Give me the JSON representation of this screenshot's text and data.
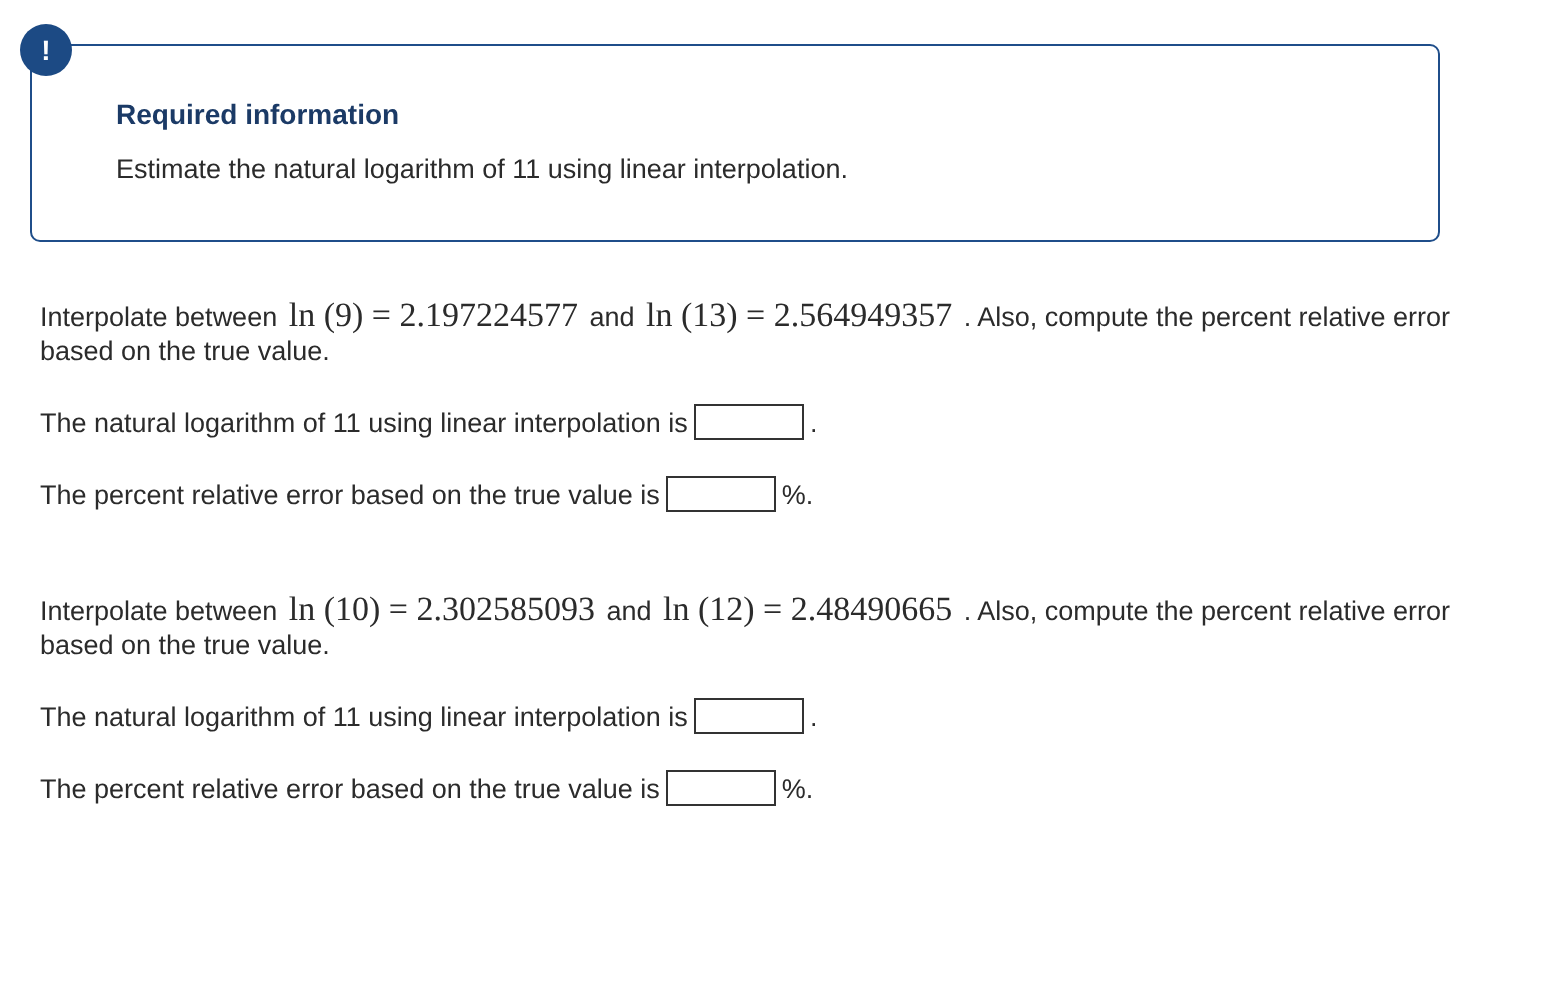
{
  "alert": {
    "icon_text": "!",
    "title": "Required information",
    "text": "Estimate the natural logarithm of 11 using linear interpolation."
  },
  "parts": [
    {
      "intro": [
        {
          "kind": "text",
          "text": "Interpolate between "
        },
        {
          "kind": "math",
          "text": "ln (9) = 2.197224577"
        },
        {
          "kind": "text",
          "text": " and "
        },
        {
          "kind": "math",
          "text": "ln (13) = 2.564949357"
        },
        {
          "kind": "text",
          "text": " . Also, compute the percent relative error based on the true value."
        }
      ],
      "answers": [
        {
          "label": "The natural logarithm of 11 using linear interpolation is",
          "suffix": "."
        },
        {
          "label": "The percent relative error based on the true value is",
          "suffix": "%."
        }
      ]
    },
    {
      "intro": [
        {
          "kind": "text",
          "text": "Interpolate between "
        },
        {
          "kind": "math",
          "text": "ln (10) = 2.302585093"
        },
        {
          "kind": "text",
          "text": " and "
        },
        {
          "kind": "math",
          "text": "ln (12) = 2.48490665"
        },
        {
          "kind": "text",
          "text": " . Also, compute the percent relative error based on the true value."
        }
      ],
      "answers": [
        {
          "label": "The natural logarithm of 11 using linear interpolation is",
          "suffix": "."
        },
        {
          "label": "The percent relative error based on the true value is",
          "suffix": "%."
        }
      ]
    }
  ]
}
